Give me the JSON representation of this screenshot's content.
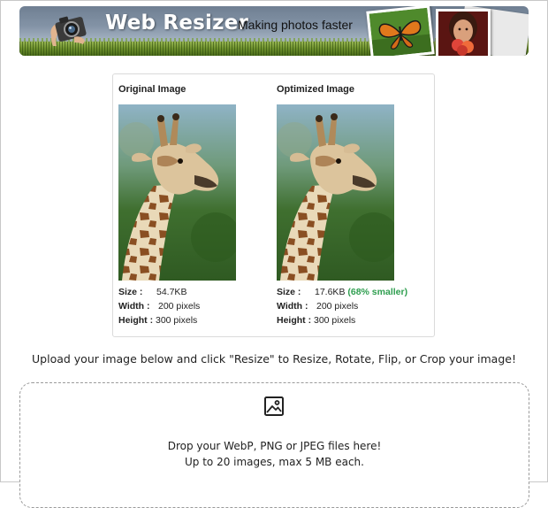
{
  "banner": {
    "title": "Web Resizer",
    "tagline": "Making photos faster"
  },
  "comparison": {
    "original": {
      "title": "Original Image",
      "size_label": "Size :",
      "size_value": "54.7KB",
      "width_label": "Width :",
      "width_value": "200 pixels",
      "height_label": "Height :",
      "height_value": "300 pixels"
    },
    "optimized": {
      "title": "Optimized Image",
      "size_label": "Size :",
      "size_value": "17.6KB",
      "saving": "(68% smaller)",
      "width_label": "Width :",
      "width_value": "200 pixels",
      "height_label": "Height :",
      "height_value": "300 pixels"
    }
  },
  "instructions": "Upload your image below and click \"Resize\" to Resize, Rotate, Flip, or Crop your image!",
  "dropzone": {
    "icon": "image-icon",
    "line1": "Drop your WebP, PNG or JPEG files here!",
    "line2": "Up to 20 images, max 5 MB each."
  },
  "colors": {
    "saving_green": "#2e9e4f",
    "dropzone_border": "#9a9a9a",
    "card_border": "#dadada"
  }
}
